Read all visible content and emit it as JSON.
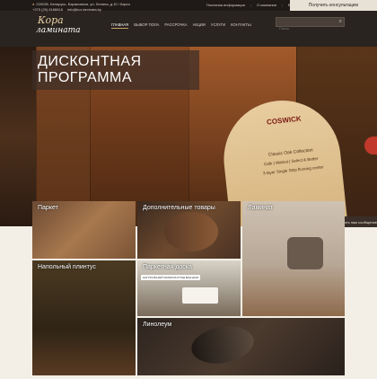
{
  "header": {
    "address": "220035, Беларусь, Барановичи, ул. Ленина, д.10 / Карта",
    "phone": "+375 (29) 6186818",
    "email": "info@kor-laminata.by",
    "top_links": [
      "Полезная информация",
      "О компании",
      "Вакансии"
    ],
    "consult_button": "Получить консультацию",
    "logo_line1": "Кора",
    "logo_line2": "ламината",
    "nav": [
      "ГЛАВНАЯ",
      "ВЫБОР ПОЛА",
      "РАССРОЧКА",
      "АКЦИИ",
      "УСЛУГИ",
      "КОНТАКТЫ"
    ],
    "search_placeholder": "Поиск"
  },
  "hero": {
    "title_line1": "ДИСКОНТНАЯ",
    "title_line2": "ПРОГРАММА",
    "tag_brand": "COSWICK",
    "tag_line1": "Classic Oak Collection",
    "tag_line2": "Cafe | Walnut | Select & Better",
    "tag_line3": "3-layer Single Strip flooring center"
  },
  "tiles": {
    "parket": "Паркет",
    "dop": "Дополнительные товары",
    "laminat": "Ламинат",
    "plintus": "Напольный плинтус",
    "doska": "Паркетная доска",
    "doska_badge": "НАТУРАЛЬНЫЙ МАТЕРИАЛ ПОД ВАШ ДОМ",
    "linoleum": "Линолеум"
  },
  "sidetab": {
    "label": "Отправить нам сообщение"
  },
  "colors": {
    "header_bg": "#2a2420",
    "accent": "#c8a270",
    "consult_bg": "#e8e1d6"
  }
}
